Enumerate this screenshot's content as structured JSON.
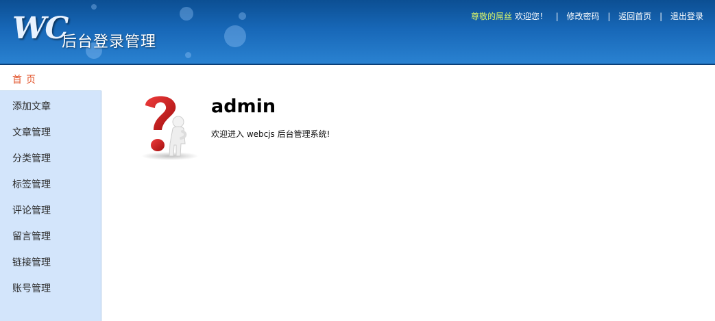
{
  "header": {
    "logo_text": "WC",
    "title": "后台登录管理",
    "username": "尊敬的屌丝",
    "greeting": "欢迎您！",
    "separator": "|",
    "change_password": "修改密码",
    "back_home": "返回首页",
    "logout": "退出登录"
  },
  "sidebar": {
    "home": "首页",
    "items": [
      {
        "label": "添加文章"
      },
      {
        "label": "文章管理"
      },
      {
        "label": "分类管理"
      },
      {
        "label": "标签管理"
      },
      {
        "label": "评论管理"
      },
      {
        "label": "留言管理"
      },
      {
        "label": "链接管理"
      },
      {
        "label": "账号管理"
      }
    ]
  },
  "main": {
    "title": "admin",
    "welcome": "欢迎进入 webcjs 后台管理系统!"
  },
  "colors": {
    "header_top": "#0c4f93",
    "header_bottom": "#2a82d1",
    "username": "#d6f26a",
    "home_active": "#e2532a",
    "sidebar_bg": "#d3e5fb",
    "question_red": "#cc1a1a"
  },
  "icons": {
    "main_illustration": "question-mark-figure-icon"
  }
}
